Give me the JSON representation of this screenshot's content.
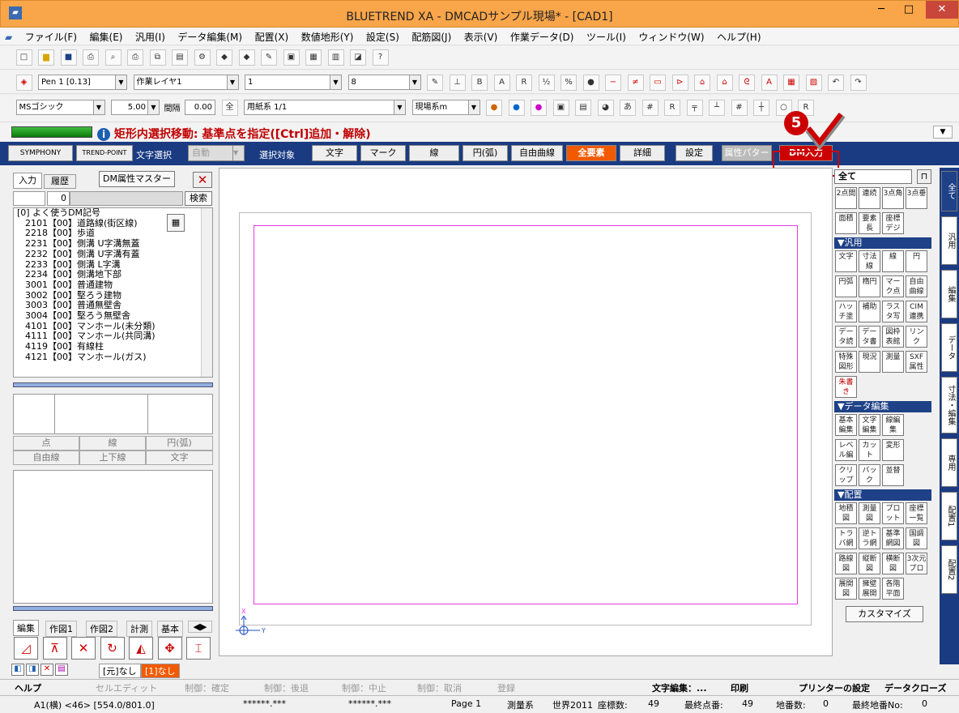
{
  "window": {
    "title": "BLUETREND XA - DMCADサンプル現場* - [CAD1]",
    "minimize": "─",
    "maximize": "□",
    "close": "✕",
    "app_icon": "bluetrend-app-icon"
  },
  "menu": [
    "ファイル(F)",
    "編集(E)",
    "汎用(I)",
    "データ編集(M)",
    "配置(X)",
    "数値地形(Y)",
    "設定(S)",
    "配筋図(J)",
    "表示(V)",
    "作業データ(D)",
    "ツール(I)",
    "ウィンドウ(W)",
    "ヘルプ(H)"
  ],
  "toolbar2": {
    "pen": "Pen 1 [0.13]",
    "layer": "作業レイヤ1",
    "line": "1",
    "size": "8"
  },
  "toolbar3": {
    "font": "MSゴシック",
    "size": "5.00",
    "spacing_label": "間隔",
    "spacing": "0.00",
    "all": "全",
    "paper": "用紙系 1/1",
    "coord": "現場系m"
  },
  "status_msg": "矩形内選択移動: 基準点を指定([Ctrl]追加・解除)",
  "bluebar": {
    "logo1": "SYMPHONY",
    "logo2": "TREND-POINT",
    "text_select": "文字選択",
    "auto": "自動",
    "target": "選択対象",
    "buttons": [
      "文字",
      "マーク",
      "線",
      "円(弧)",
      "自由曲線",
      "全要素",
      "詳細"
    ],
    "settings": "設定",
    "attr": "属性パターン",
    "dm_input": "DM入力",
    "callout": "5"
  },
  "left": {
    "tab_input": "入力",
    "tab_history": "履歴",
    "dm_master": "DM属性マスター",
    "search_value": "0",
    "search_btn": "検索",
    "tree": [
      "[0] よく使うDM記号",
      "2101【00】道路線(街区線)",
      "2218【00】歩道",
      "2231【00】側溝 U字溝無蓋",
      "2232【00】側溝 U字溝有蓋",
      "2233【00】側溝 L字溝",
      "2234【00】側溝地下部",
      "3001【00】普通建物",
      "3002【00】堅ろう建物",
      "3003【00】普通無壁舎",
      "3004【00】堅ろう無壁舎",
      "4101【00】マンホール(未分類)",
      "4111【00】マンホール(共同溝)",
      "4119【00】有線柱",
      "4121【00】マンホール(ガス)"
    ],
    "types": [
      "点",
      "線",
      "円(弧)",
      "自由線",
      "上下線",
      "文字"
    ],
    "bottom_tabs": [
      "編集",
      "作図1",
      "作図2",
      "計測",
      "基本"
    ],
    "layer_labels": [
      "[元]なし",
      "[1]なし"
    ]
  },
  "canvas": {
    "axis_x": "X",
    "axis_y": "Y"
  },
  "right": {
    "header": "全て",
    "top": [
      "2点間",
      "連続",
      "3点角",
      "3点垂",
      "面積",
      "要素長",
      "座標デジ"
    ],
    "sec1": "▼汎用",
    "g1": [
      "文字",
      "寸法線",
      "線",
      "円",
      "円弧",
      "楕円",
      "マーク点",
      "自由曲線",
      "ハッチ塗り",
      "補助",
      "ラスタ写真",
      "CIM連携",
      "データ読込",
      "データ書込",
      "図枠表館",
      "リンク",
      "特殊図形",
      "現況",
      "測量",
      "SXF属性",
      "朱書き"
    ],
    "sec2": "▼データ編集",
    "g2": [
      "基本編集",
      "文字編集",
      "線編集",
      "レベル編集",
      "カット",
      "変形",
      "クリップボード",
      "バック",
      "並替"
    ],
    "sec3": "▼配置",
    "g3": [
      "地積図",
      "測量図",
      "プロット図",
      "座標一覧",
      "トラバ網図",
      "逆トラ網図",
      "基準網図",
      "国調図",
      "路線図",
      "縦断図",
      "横断図",
      "3次元プロット",
      "展開図",
      "擁壁展開",
      "各階平面"
    ],
    "customize": "カスタマイズ",
    "vtabs": [
      "全て",
      "汎用",
      "編集",
      "データ",
      "寸法・編集",
      "専用",
      "配置1",
      "配置2"
    ]
  },
  "bottom": {
    "help": "ヘルプ",
    "cols": [
      "セルエディット",
      "制御：確定",
      "制御：後退",
      "制御：中止",
      "制御：取消",
      "登録"
    ],
    "text_edit": "文字編集：...",
    "print": "印刷",
    "printer": "プリンターの設定",
    "close": "データクローズ",
    "coord": "A1(横) <46> [554.0/801.0]",
    "f1": "******.***",
    "f2": "******.***",
    "page": "Page 1",
    "system": "測量系",
    "world": "世界2011",
    "coords_label": "座標数:",
    "coords": "49",
    "last_label": "最終点番:",
    "last": "49",
    "lots_label": "地番数:",
    "lots": "0",
    "lastlot_label": "最終地番No:",
    "lastlot": "0"
  }
}
